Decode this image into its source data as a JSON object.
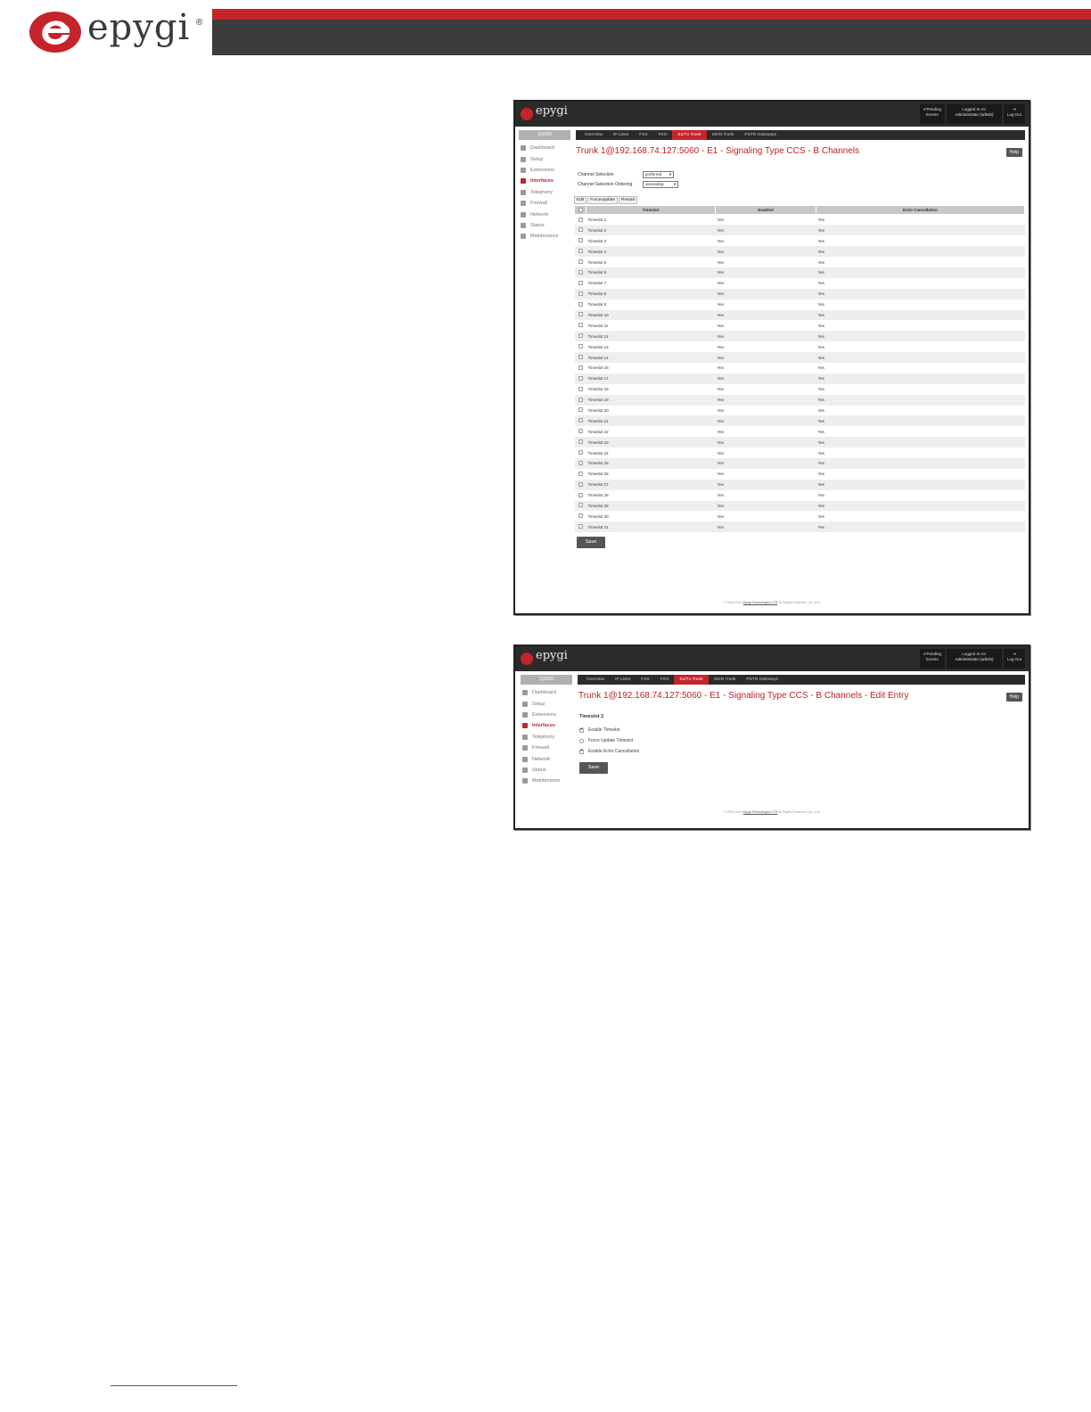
{
  "brand": {
    "name": "epygi",
    "reg": "®",
    "red": "#c5242b",
    "dark": "#3c3c3c"
  },
  "app": {
    "logo": "epygi",
    "pending": [
      "Pending",
      "Events"
    ],
    "logged_in_label": "Logged In As:",
    "logged_in_user": "Administrator (admin)",
    "logout": "Log Out",
    "model": "QX200",
    "sidebar": [
      "Dashboard",
      "Setup",
      "Extensions",
      "Interfaces",
      "Telephony",
      "Firewall",
      "Network",
      "Status",
      "Maintenance"
    ],
    "active_sidebar": "Interfaces",
    "tabs": [
      "Overview",
      "IP Lines",
      "FXS",
      "FXO",
      "E1/T1 Trunk",
      "ISDN Trunk",
      "PSTN Gateways"
    ],
    "active_tab": "E1/T1 Trunk",
    "help": "Help",
    "save": "Save",
    "copyright_prefix": "© 2005-2014",
    "copyright_link": "Epygi Technologies LTD",
    "copyright_suffix": "All Rights Reserved. (en_US)"
  },
  "shot1": {
    "title": "Trunk 1@192.168.74.127:5060 - E1 - Signaling Type CCS - B Channels",
    "channel_selection": {
      "label": "Channel Selection",
      "value": "preferred"
    },
    "channel_ordering": {
      "label": "Channel Selection Ordering",
      "value": "ascending"
    },
    "buttons": [
      "Edit",
      "ForceUpdate",
      "Restart"
    ],
    "columns": [
      "Timeslot",
      "Enabled",
      "Echo Cancellation"
    ],
    "rows": [
      [
        "Timeslot 1",
        "Yes",
        "Yes"
      ],
      [
        "Timeslot 2",
        "Yes",
        "Yes"
      ],
      [
        "Timeslot 3",
        "Yes",
        "Yes"
      ],
      [
        "Timeslot 4",
        "Yes",
        "Yes"
      ],
      [
        "Timeslot 5",
        "Yes",
        "Yes"
      ],
      [
        "Timeslot 6",
        "Yes",
        "Yes"
      ],
      [
        "Timeslot 7",
        "Yes",
        "Yes"
      ],
      [
        "Timeslot 8",
        "Yes",
        "Yes"
      ],
      [
        "Timeslot 9",
        "Yes",
        "Yes"
      ],
      [
        "Timeslot 10",
        "Yes",
        "Yes"
      ],
      [
        "Timeslot 11",
        "Yes",
        "Yes"
      ],
      [
        "Timeslot 12",
        "Yes",
        "Yes"
      ],
      [
        "Timeslot 13",
        "Yes",
        "Yes"
      ],
      [
        "Timeslot 14",
        "Yes",
        "Yes"
      ],
      [
        "Timeslot 15",
        "Yes",
        "Yes"
      ],
      [
        "Timeslot 17",
        "Yes",
        "Yes"
      ],
      [
        "Timeslot 18",
        "Yes",
        "Yes"
      ],
      [
        "Timeslot 19",
        "Yes",
        "Yes"
      ],
      [
        "Timeslot 20",
        "Yes",
        "Yes"
      ],
      [
        "Timeslot 21",
        "Yes",
        "Yes"
      ],
      [
        "Timeslot 22",
        "Yes",
        "Yes"
      ],
      [
        "Timeslot 23",
        "Yes",
        "Yes"
      ],
      [
        "Timeslot 24",
        "Yes",
        "Yes"
      ],
      [
        "Timeslot 25",
        "Yes",
        "Yes"
      ],
      [
        "Timeslot 26",
        "Yes",
        "Yes"
      ],
      [
        "Timeslot 27",
        "Yes",
        "Yes"
      ],
      [
        "Timeslot 28",
        "Yes",
        "Yes"
      ],
      [
        "Timeslot 29",
        "Yes",
        "Yes"
      ],
      [
        "Timeslot 30",
        "Yes",
        "Yes"
      ],
      [
        "Timeslot 31",
        "Yes",
        "Yes"
      ]
    ]
  },
  "shot2": {
    "title": "Trunk 1@192.168.74.127:5060 - E1 - Signaling Type CCS - B Channels - Edit Entry",
    "timeslot": "Timeslot 2",
    "options": [
      {
        "label": "Enable Timeslot",
        "checked": true
      },
      {
        "label": "Force Update Timeslot",
        "checked": false
      },
      {
        "label": "Enable Echo Cancellation",
        "checked": true
      }
    ]
  }
}
